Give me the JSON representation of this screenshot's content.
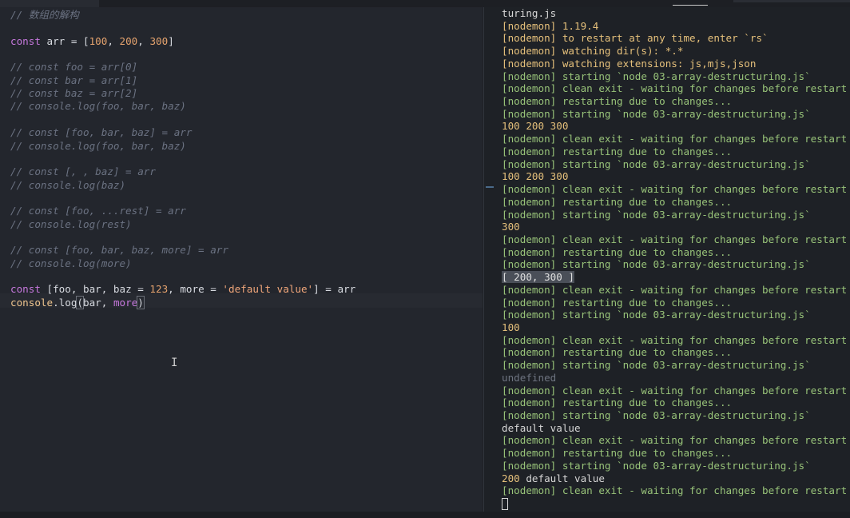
{
  "editor": {
    "lines": [
      {
        "parts": [
          {
            "t": "// 数组的解构",
            "c": "cm"
          }
        ]
      },
      {
        "parts": []
      },
      {
        "parts": [
          {
            "t": "const",
            "c": "kw"
          },
          {
            "t": " arr = [",
            "c": "fn"
          },
          {
            "t": "100",
            "c": "num"
          },
          {
            "t": ", ",
            "c": "fn"
          },
          {
            "t": "200",
            "c": "num"
          },
          {
            "t": ", ",
            "c": "fn"
          },
          {
            "t": "300",
            "c": "num"
          },
          {
            "t": "]",
            "c": "fn"
          }
        ]
      },
      {
        "parts": []
      },
      {
        "parts": [
          {
            "t": "// const foo = arr[0]",
            "c": "cm"
          }
        ]
      },
      {
        "parts": [
          {
            "t": "// const bar = arr[1]",
            "c": "cm"
          }
        ]
      },
      {
        "parts": [
          {
            "t": "// const baz = arr[2]",
            "c": "cm"
          }
        ]
      },
      {
        "parts": [
          {
            "t": "// console.log(foo, bar, baz)",
            "c": "cm"
          }
        ]
      },
      {
        "parts": []
      },
      {
        "parts": [
          {
            "t": "// const [foo, bar, baz] = arr",
            "c": "cm"
          }
        ]
      },
      {
        "parts": [
          {
            "t": "// console.log(foo, bar, baz)",
            "c": "cm"
          }
        ]
      },
      {
        "parts": []
      },
      {
        "parts": [
          {
            "t": "// const [, , baz] = arr",
            "c": "cm"
          }
        ]
      },
      {
        "parts": [
          {
            "t": "// console.log(baz)",
            "c": "cm"
          }
        ]
      },
      {
        "parts": []
      },
      {
        "parts": [
          {
            "t": "// const [foo, ...rest] = arr",
            "c": "cm"
          }
        ]
      },
      {
        "parts": [
          {
            "t": "// console.log(rest)",
            "c": "cm"
          }
        ]
      },
      {
        "parts": []
      },
      {
        "parts": [
          {
            "t": "// const [foo, bar, baz, more] = arr",
            "c": "cm"
          }
        ]
      },
      {
        "parts": [
          {
            "t": "// console.log(more)",
            "c": "cm"
          }
        ]
      },
      {
        "parts": []
      },
      {
        "parts": [
          {
            "t": "const",
            "c": "kw"
          },
          {
            "t": " [foo, bar, baz = ",
            "c": "fn"
          },
          {
            "t": "123",
            "c": "num"
          },
          {
            "t": ", more = ",
            "c": "fn"
          },
          {
            "t": "'default value'",
            "c": "str"
          },
          {
            "t": "] = arr",
            "c": "fn"
          }
        ]
      },
      {
        "parts": [
          {
            "t": "console",
            "c": "var"
          },
          {
            "t": ".",
            "c": "fn"
          },
          {
            "t": "log",
            "c": "fn"
          },
          {
            "t": "(",
            "c": "fn hl"
          },
          {
            "t": "bar, ",
            "c": "fn"
          },
          {
            "t": "more",
            "c": "kw"
          },
          {
            "t": ")",
            "c": "fn hl"
          }
        ]
      }
    ]
  },
  "terminal": {
    "lines": [
      {
        "text": "turing.js",
        "c": "t-plain"
      },
      {
        "text": "[nodemon] 1.19.4",
        "c": "t-yellow"
      },
      {
        "text": "[nodemon] to restart at any time, enter `rs`",
        "c": "t-yellow"
      },
      {
        "text": "[nodemon] watching dir(s): *.*",
        "c": "t-yellow"
      },
      {
        "text": "[nodemon] watching extensions: js,mjs,json",
        "c": "t-yellow"
      },
      {
        "text": "[nodemon] starting `node 03-array-destructuring.js`",
        "c": "t-green"
      },
      {
        "text": "[nodemon] clean exit - waiting for changes before restart",
        "c": "t-green"
      },
      {
        "text": "[nodemon] restarting due to changes...",
        "c": "t-green"
      },
      {
        "text": "[nodemon] starting `node 03-array-destructuring.js`",
        "c": "t-green"
      },
      {
        "text": "100 200 300",
        "c": "t-out"
      },
      {
        "text": "[nodemon] clean exit - waiting for changes before restart",
        "c": "t-green"
      },
      {
        "text": "[nodemon] restarting due to changes...",
        "c": "t-green"
      },
      {
        "text": "[nodemon] starting `node 03-array-destructuring.js`",
        "c": "t-green"
      },
      {
        "text": "100 200 300",
        "c": "t-out"
      },
      {
        "text": "[nodemon] clean exit - waiting for changes before restart",
        "c": "t-green"
      },
      {
        "text": "[nodemon] restarting due to changes...",
        "c": "t-green"
      },
      {
        "text": "[nodemon] starting `node 03-array-destructuring.js`",
        "c": "t-green"
      },
      {
        "text": "300",
        "c": "t-out"
      },
      {
        "text": "[nodemon] clean exit - waiting for changes before restart",
        "c": "t-green"
      },
      {
        "text": "[nodemon] restarting due to changes...",
        "c": "t-green"
      },
      {
        "text": "[nodemon] starting `node 03-array-destructuring.js`",
        "c": "t-green"
      },
      {
        "text": "[ 200, 300 ]",
        "c": "t-out sel"
      },
      {
        "text": "[nodemon] clean exit - waiting for changes before restart",
        "c": "t-green"
      },
      {
        "text": "[nodemon] restarting due to changes...",
        "c": "t-green"
      },
      {
        "text": "[nodemon] starting `node 03-array-destructuring.js`",
        "c": "t-green"
      },
      {
        "text": "100",
        "c": "t-out"
      },
      {
        "text": "[nodemon] clean exit - waiting for changes before restart",
        "c": "t-green"
      },
      {
        "text": "[nodemon] restarting due to changes...",
        "c": "t-green"
      },
      {
        "text": "[nodemon] starting `node 03-array-destructuring.js`",
        "c": "t-green"
      },
      {
        "text": "undefined",
        "c": "t-gray"
      },
      {
        "text": "[nodemon] clean exit - waiting for changes before restart",
        "c": "t-green"
      },
      {
        "text": "[nodemon] restarting due to changes...",
        "c": "t-green"
      },
      {
        "text": "[nodemon] starting `node 03-array-destructuring.js`",
        "c": "t-green"
      },
      {
        "text": "default value",
        "c": "t-plain"
      },
      {
        "text": "[nodemon] clean exit - waiting for changes before restart",
        "c": "t-green"
      },
      {
        "text": "[nodemon] restarting due to changes...",
        "c": "t-green"
      },
      {
        "text": "[nodemon] starting `node 03-array-destructuring.js`",
        "c": "t-green"
      },
      {
        "text": "200 default value",
        "c": "t-mixed"
      },
      {
        "text": "[nodemon] clean exit - waiting for changes before restart",
        "c": "t-green"
      }
    ]
  },
  "colors": {
    "editor_bg": "#23262d",
    "terminal_bg": "#1e2126",
    "keyword": "#c678dd",
    "number": "#e5a36e",
    "nodemon_yellow": "#e5c07b",
    "nodemon_green": "#98c379"
  }
}
